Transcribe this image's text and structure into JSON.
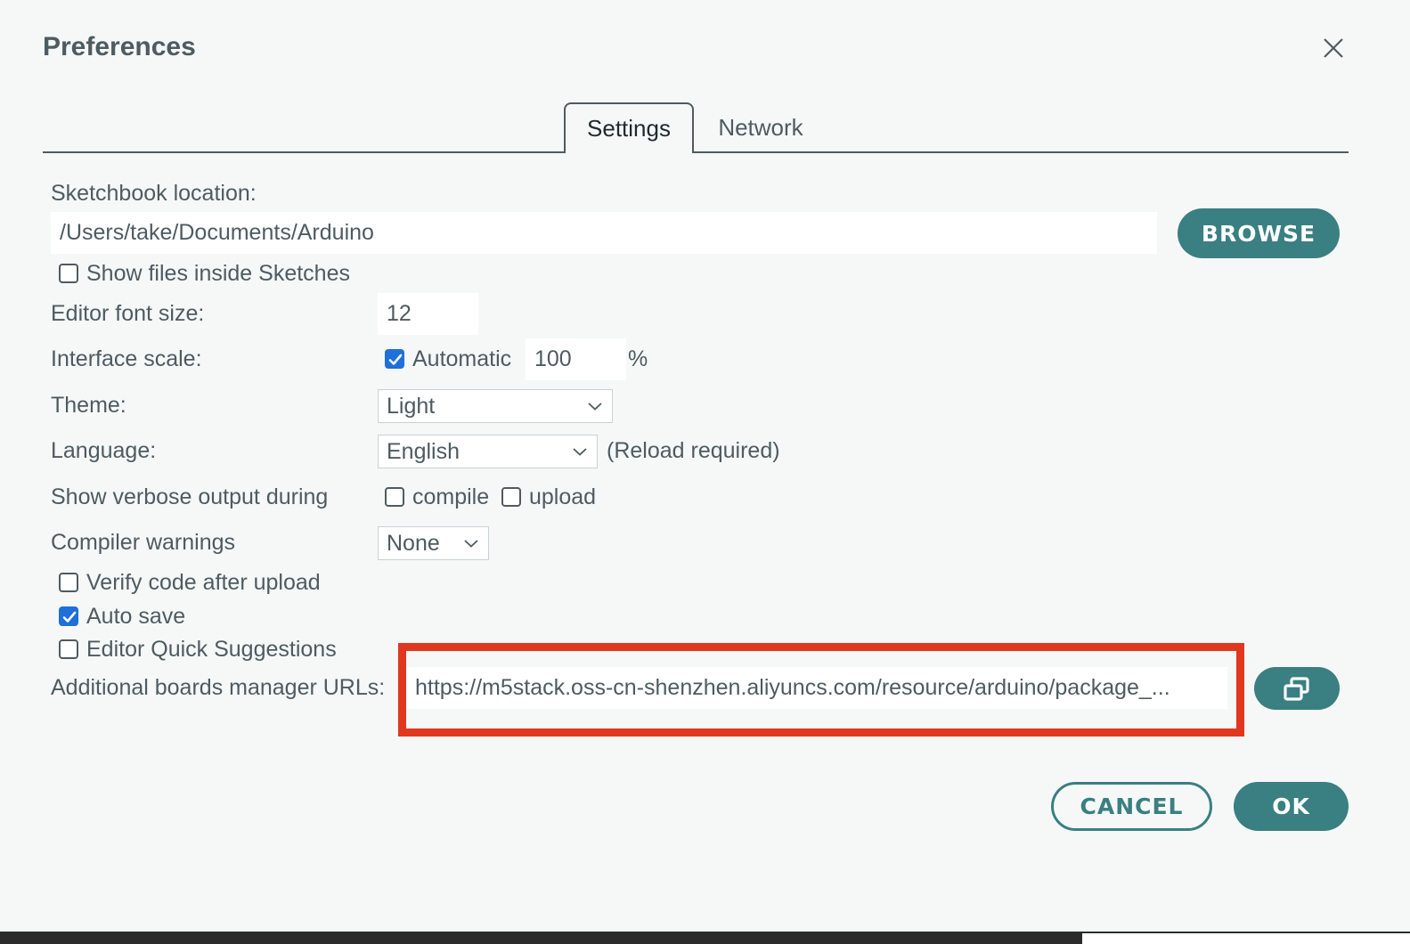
{
  "dialog": {
    "title": "Preferences",
    "close_icon": "close-icon"
  },
  "tabs": [
    {
      "label": "Settings",
      "active": true
    },
    {
      "label": "Network",
      "active": false
    }
  ],
  "sketchbook": {
    "label": "Sketchbook location:",
    "value": "/Users/take/Documents/Arduino",
    "browse_label": "BROWSE"
  },
  "show_files": {
    "label": "Show files inside Sketches",
    "checked": false
  },
  "font_size": {
    "label": "Editor font size:",
    "value": "12"
  },
  "interface_scale": {
    "label": "Interface scale:",
    "automatic_label": "Automatic",
    "automatic_checked": true,
    "value": "100",
    "unit": "%"
  },
  "theme": {
    "label": "Theme:",
    "value": "Light"
  },
  "language": {
    "label": "Language:",
    "value": "English",
    "note": "(Reload required)"
  },
  "verbose": {
    "label": "Show verbose output during",
    "compile_label": "compile",
    "compile_checked": false,
    "upload_label": "upload",
    "upload_checked": false
  },
  "compiler_warnings": {
    "label": "Compiler warnings",
    "value": "None"
  },
  "verify": {
    "label": "Verify code after upload",
    "checked": false
  },
  "auto_save": {
    "label": "Auto save",
    "checked": true
  },
  "quick_suggestions": {
    "label": "Editor Quick Suggestions",
    "checked": false
  },
  "boards_urls": {
    "label": "Additional boards manager URLs:",
    "value": "https://m5stack.oss-cn-shenzhen.aliyuncs.com/resource/arduino/package_...",
    "edit_icon": "open-window-icon"
  },
  "footer": {
    "cancel_label": "CANCEL",
    "ok_label": "OK"
  },
  "colors": {
    "accent": "#3a7f82",
    "checkbox_checked": "#1e6fd9",
    "highlight_box": "#e0371f",
    "text": "#4e5b61",
    "background": "#f6f8f8"
  }
}
